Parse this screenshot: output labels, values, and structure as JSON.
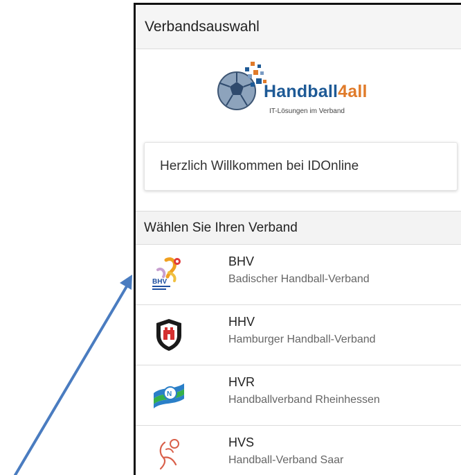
{
  "appbar": {
    "title": "Verbandsauswahl"
  },
  "logo": {
    "title_main": "Handball",
    "title_four": "4",
    "title_all": "all",
    "subtitle": "IT-Lösungen im Verband"
  },
  "welcome": {
    "text": "Herzlich Willkommen bei IDOnline"
  },
  "section": {
    "title": "Wählen Sie Ihren Verband"
  },
  "associations": [
    {
      "code": "BHV",
      "name": "Badischer Handball-Verband",
      "icon": "bhv-logo-icon"
    },
    {
      "code": "HHV",
      "name": "Hamburger Handball-Verband",
      "icon": "hhv-logo-icon"
    },
    {
      "code": "HVR",
      "name": "Handballverband Rheinhessen",
      "icon": "hvr-logo-icon"
    },
    {
      "code": "HVS",
      "name": "Handball-Verband Saar",
      "icon": "hvs-logo-icon"
    }
  ],
  "colors": {
    "brand_blue": "#1e5a96",
    "brand_orange": "#e07b2a",
    "arrow": "#4a7cc0"
  }
}
